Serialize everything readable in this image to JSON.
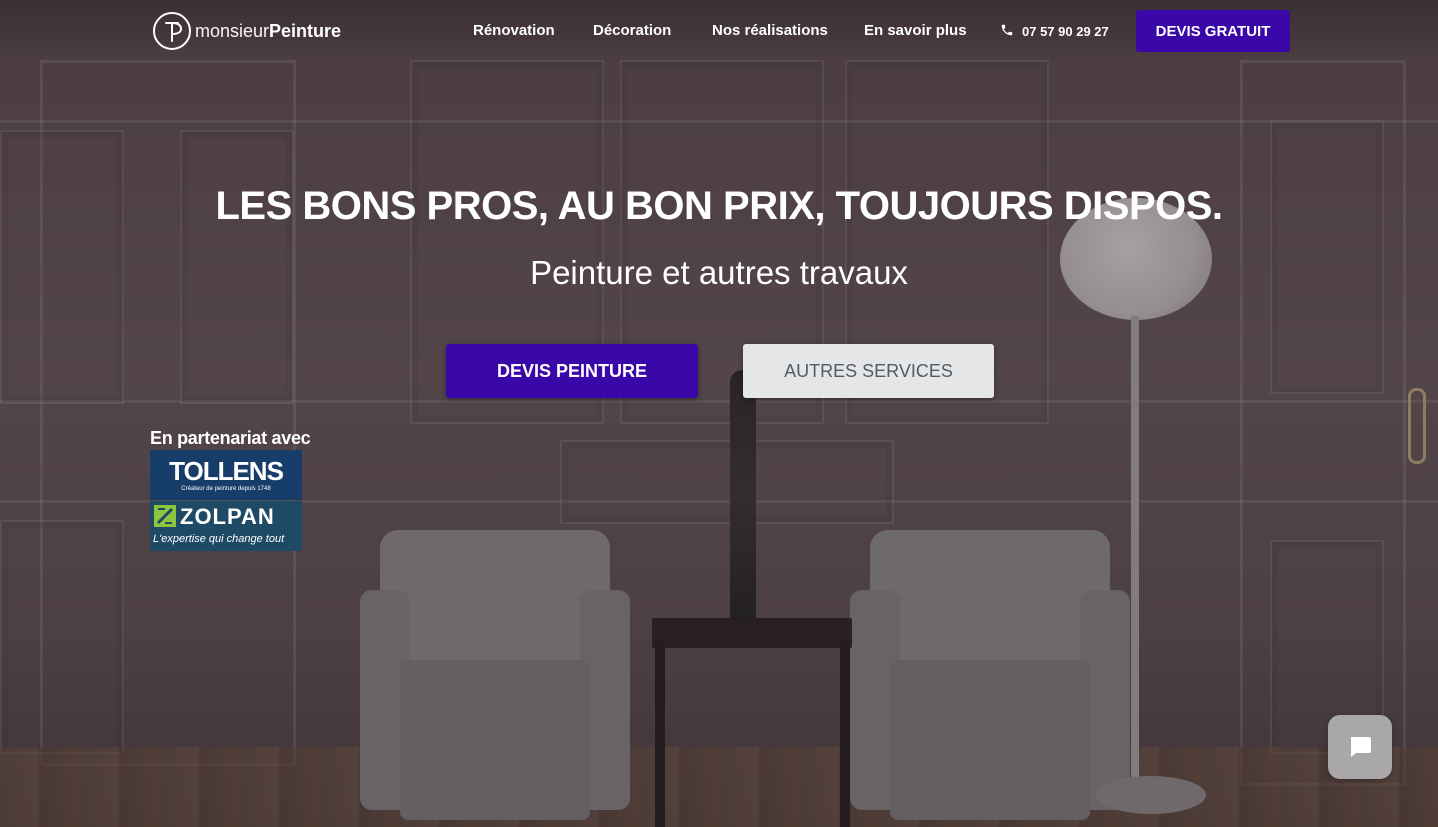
{
  "header": {
    "logo": {
      "text_light": "monsieur",
      "text_bold": "Peinture"
    },
    "nav": [
      {
        "label": "Rénovation"
      },
      {
        "label": "Décoration"
      },
      {
        "label": "Nos réalisations"
      },
      {
        "label": "En savoir plus"
      }
    ],
    "phone": {
      "icon": "phone-icon",
      "number": "07 57 90 29 27"
    },
    "cta_label": "DEVIS GRATUIT"
  },
  "hero": {
    "title": "LES BONS PROS, AU BON PRIX, TOUJOURS DISPOS.",
    "subtitle": "Peinture et autres travaux",
    "primary_button": "DEVIS PEINTURE",
    "secondary_button": "AUTRES SERVICES"
  },
  "partners": {
    "label": "En partenariat avec",
    "tollens": {
      "name": "TOLLENS",
      "tagline": "Créateur de peinture depuis 1748"
    },
    "zolpan": {
      "name": "ZOLPAN",
      "tagline": "L'expertise qui change tout"
    }
  },
  "chat": {
    "icon": "chat-icon"
  },
  "colors": {
    "accent": "#3a08a8",
    "secondary_button_bg": "#e4e6e8",
    "secondary_button_text": "#555b60",
    "tollens_bg": "#173d6b",
    "zolpan_bg": "#1f4a66",
    "zolpan_green": "#8cc63f"
  }
}
